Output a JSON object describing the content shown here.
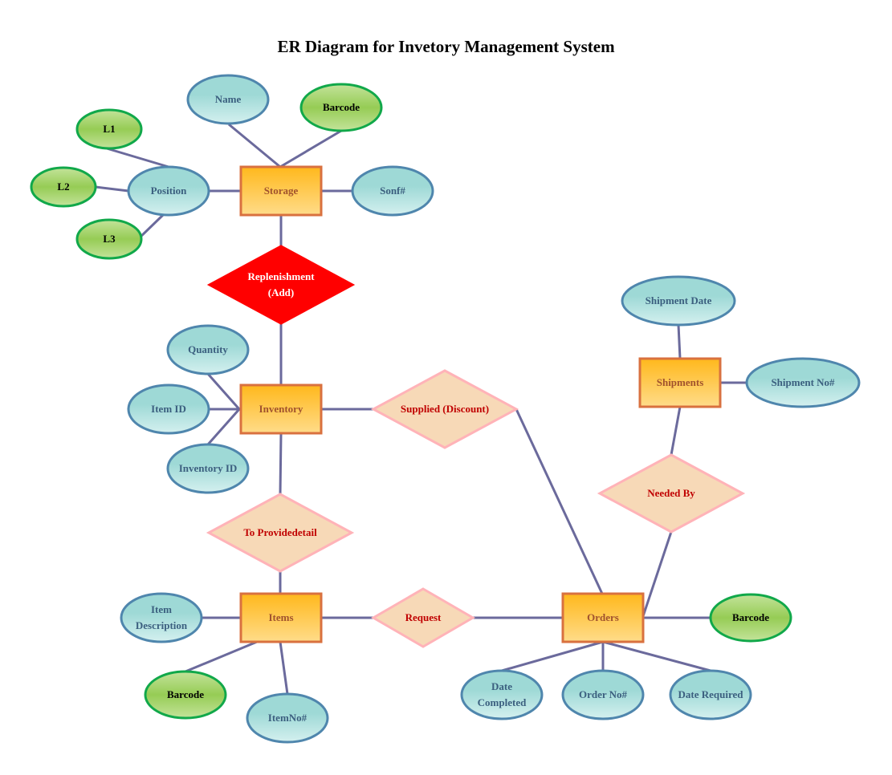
{
  "title": "ER Diagram for Invetory Management System",
  "colors": {
    "line": "#6b6a9c",
    "entity_fill_top": "#ffb81c",
    "entity_fill_bottom": "#ffdc8a",
    "entity_stroke": "#d9713f",
    "entity_text": "#a0522d",
    "attr_fill_top": "#9ed9d6",
    "attr_fill_bottom": "#d4f0ef",
    "attr_stroke": "#4f86ad",
    "attr_text": "#3b5f7f",
    "key_fill_top": "#c3e39a",
    "key_fill_mid": "#96cc55",
    "key_stroke": "#11a84a",
    "key_text": "#000000",
    "rel_fill": "#f7d9b7",
    "rel_stroke": "#ffb3b8",
    "rel_text": "#c00000",
    "rel_highlight_fill": "#ff0000",
    "rel_highlight_text": "#ffffff"
  },
  "entities": [
    {
      "id": "storage",
      "label": "Storage"
    },
    {
      "id": "inventory",
      "label": "Inventory"
    },
    {
      "id": "items",
      "label": "Items"
    },
    {
      "id": "orders",
      "label": "Orders"
    },
    {
      "id": "shipments",
      "label": "Shipments"
    }
  ],
  "relationships": [
    {
      "id": "replenishment",
      "lines": [
        "Replenishment",
        "(Add)"
      ],
      "highlight": true
    },
    {
      "id": "supplied",
      "lines": [
        "Supplied (Discount)"
      ],
      "highlight": false
    },
    {
      "id": "provide",
      "lines": [
        "To Providedetail"
      ],
      "highlight": false
    },
    {
      "id": "request",
      "lines": [
        "Request"
      ],
      "highlight": false
    },
    {
      "id": "needed",
      "lines": [
        "Needed By"
      ],
      "highlight": false
    }
  ],
  "attributes": [
    {
      "id": "name",
      "lines": [
        "Name"
      ],
      "key": false,
      "of": "storage"
    },
    {
      "id": "storage_barcode",
      "lines": [
        "Barcode"
      ],
      "key": true,
      "of": "storage"
    },
    {
      "id": "sonf",
      "lines": [
        "Sonf#"
      ],
      "key": false,
      "of": "storage"
    },
    {
      "id": "position",
      "lines": [
        "Position"
      ],
      "key": false,
      "of": "storage"
    },
    {
      "id": "l1",
      "lines": [
        "L1"
      ],
      "key": true,
      "of": "position"
    },
    {
      "id": "l2",
      "lines": [
        "L2"
      ],
      "key": true,
      "of": "position"
    },
    {
      "id": "l3",
      "lines": [
        "L3"
      ],
      "key": true,
      "of": "position"
    },
    {
      "id": "quantity",
      "lines": [
        "Quantity"
      ],
      "key": false,
      "of": "inventory"
    },
    {
      "id": "item_id",
      "lines": [
        "Item ID"
      ],
      "key": false,
      "of": "inventory"
    },
    {
      "id": "inventory_id",
      "lines": [
        "Inventory ID"
      ],
      "key": false,
      "of": "inventory"
    },
    {
      "id": "item_desc",
      "lines": [
        "Item",
        "Description"
      ],
      "key": false,
      "of": "items"
    },
    {
      "id": "items_barcode",
      "lines": [
        "Barcode"
      ],
      "key": true,
      "of": "items"
    },
    {
      "id": "itemno",
      "lines": [
        "ItemNo#"
      ],
      "key": false,
      "of": "items"
    },
    {
      "id": "orders_barcode",
      "lines": [
        "Barcode"
      ],
      "key": true,
      "of": "orders"
    },
    {
      "id": "date_completed",
      "lines": [
        "Date",
        "Completed"
      ],
      "key": false,
      "of": "orders"
    },
    {
      "id": "order_no",
      "lines": [
        "Order No#"
      ],
      "key": false,
      "of": "orders"
    },
    {
      "id": "date_required",
      "lines": [
        "Date Required"
      ],
      "key": false,
      "of": "orders"
    },
    {
      "id": "shipment_date",
      "lines": [
        "Shipment Date"
      ],
      "key": false,
      "of": "shipments"
    },
    {
      "id": "shipment_no",
      "lines": [
        "Shipment No#"
      ],
      "key": false,
      "of": "shipments"
    }
  ],
  "connections": [
    [
      "storage",
      "name"
    ],
    [
      "storage",
      "storage_barcode"
    ],
    [
      "storage",
      "sonf"
    ],
    [
      "storage",
      "position"
    ],
    [
      "position",
      "l1"
    ],
    [
      "position",
      "l2"
    ],
    [
      "position",
      "l3"
    ],
    [
      "storage",
      "replenishment"
    ],
    [
      "replenishment",
      "inventory"
    ],
    [
      "inventory",
      "quantity"
    ],
    [
      "inventory",
      "item_id"
    ],
    [
      "inventory",
      "inventory_id"
    ],
    [
      "inventory",
      "supplied"
    ],
    [
      "supplied",
      "orders"
    ],
    [
      "inventory",
      "provide"
    ],
    [
      "provide",
      "items"
    ],
    [
      "items",
      "item_desc"
    ],
    [
      "items",
      "items_barcode"
    ],
    [
      "items",
      "itemno"
    ],
    [
      "items",
      "request"
    ],
    [
      "request",
      "orders"
    ],
    [
      "orders",
      "orders_barcode"
    ],
    [
      "orders",
      "date_completed"
    ],
    [
      "orders",
      "order_no"
    ],
    [
      "orders",
      "date_required"
    ],
    [
      "orders",
      "needed"
    ],
    [
      "needed",
      "shipments"
    ],
    [
      "shipments",
      "shipment_date"
    ],
    [
      "shipments",
      "shipment_no"
    ]
  ]
}
